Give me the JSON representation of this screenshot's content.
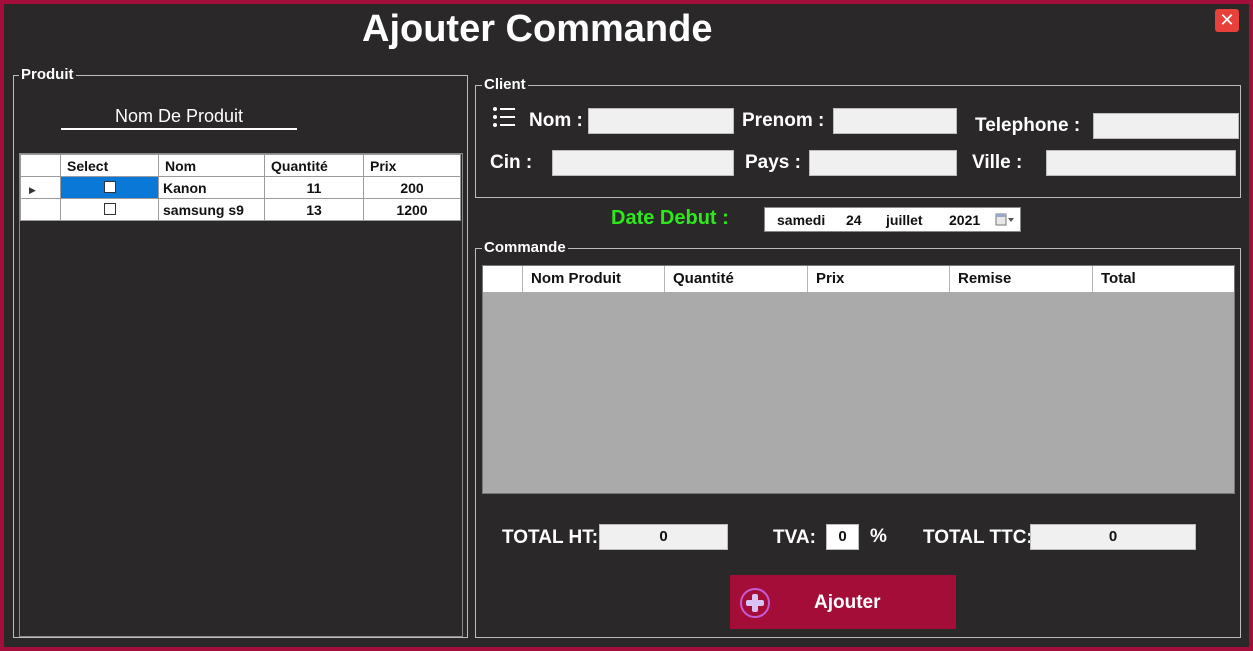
{
  "window": {
    "title": "Ajouter Commande",
    "close_glyph": "✕"
  },
  "produit": {
    "legend": "Produit",
    "search_label": "Nom De Produit",
    "columns": [
      "Select",
      "Nom",
      "Quantité",
      "Prix"
    ],
    "rows": [
      {
        "selected": false,
        "nom": "Kanon",
        "quantite": "11",
        "prix": "200"
      },
      {
        "selected": false,
        "nom": "samsung s9",
        "quantite": "13",
        "prix": "1200"
      }
    ]
  },
  "client": {
    "legend": "Client",
    "nom_label": "Nom :",
    "prenom_label": "Prenom :",
    "telephone_label": "Telephone :",
    "cin_label": "Cin :",
    "pays_label": "Pays :",
    "ville_label": "Ville :",
    "nom_value": "",
    "prenom_value": "",
    "telephone_value": "",
    "cin_value": "",
    "pays_value": "",
    "ville_value": ""
  },
  "date": {
    "label": "Date Debut :",
    "day_name": "samedi",
    "day": "24",
    "month": "juillet",
    "year": "2021"
  },
  "commande": {
    "legend": "Commande",
    "columns": [
      "Nom Produit",
      "Quantité",
      "Prix",
      "Remise",
      "Total"
    ]
  },
  "totals": {
    "total_ht_label": "TOTAL HT:",
    "total_ht_value": "0",
    "tva_label": "TVA:",
    "tva_value": "0",
    "percent": "%",
    "total_ttc_label": "TOTAL TTC:",
    "total_ttc_value": "0"
  },
  "actions": {
    "ajouter_label": "Ajouter"
  },
  "colors": {
    "accent": "#a50d39",
    "date_label": "#2ee81c",
    "selection": "#0a78d7",
    "background": "#2a2829"
  }
}
